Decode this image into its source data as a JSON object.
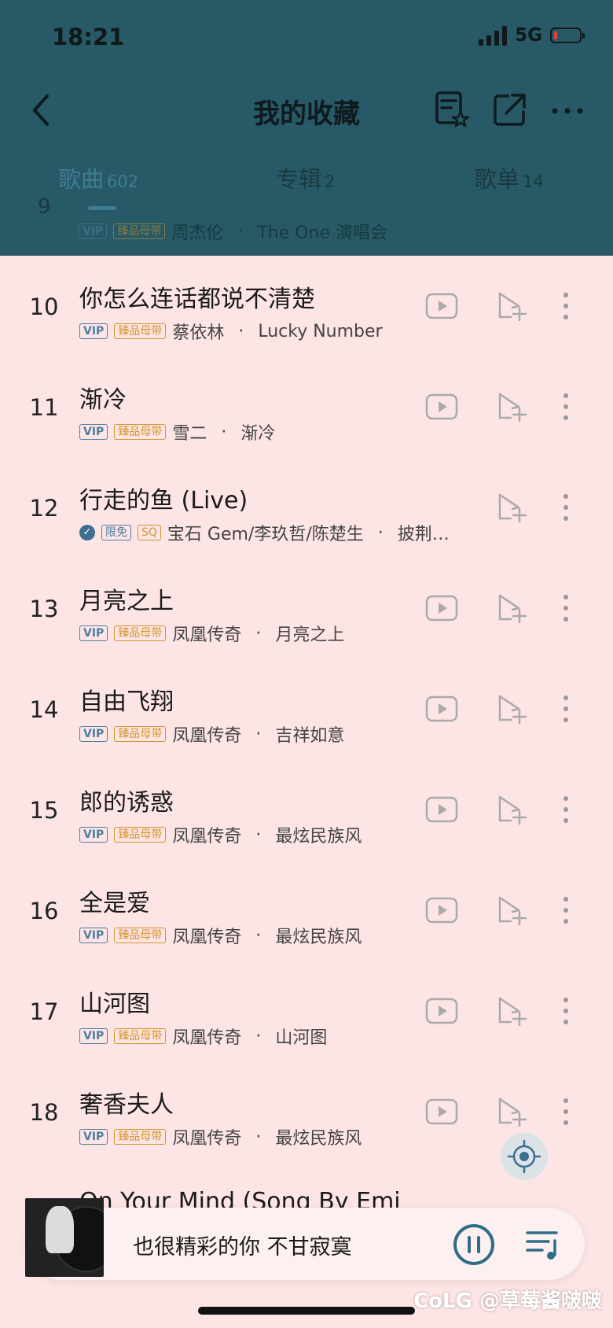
{
  "status_bar": {
    "time": "18:21",
    "network": "5G"
  },
  "nav": {
    "title": "我的收藏"
  },
  "tabs": [
    {
      "label": "歌曲",
      "count": "602"
    },
    {
      "label": "专辑",
      "count": "2"
    },
    {
      "label": "歌单",
      "count": "14"
    }
  ],
  "ghost_row": {
    "num": "9",
    "badge_vip": "VIP",
    "badge_gold": "臻品母带",
    "artist": "周杰伦",
    "dot": "·",
    "album": "The One 演唱会"
  },
  "songs": [
    {
      "num": "10",
      "title": "你怎么连话都说不清楚",
      "badge_vip": "VIP",
      "badge_gold": "臻品母带",
      "artist": "蔡依林",
      "dot": "·",
      "album": "Lucky Number"
    },
    {
      "num": "11",
      "title": "渐冷",
      "badge_vip": "VIP",
      "badge_gold": "臻品母带",
      "artist": "雪二",
      "dot": "·",
      "album": "渐冷"
    },
    {
      "num": "12",
      "title": "行走的鱼 (Live)",
      "check": "✓",
      "badge_free": "限免",
      "badge_sq": "SQ",
      "artist": "宝石 Gem/李玖哲/陈楚生",
      "dot": "·",
      "album": "披荆…"
    },
    {
      "num": "13",
      "title": "月亮之上",
      "badge_vip": "VIP",
      "badge_gold": "臻品母带",
      "artist": "凤凰传奇",
      "dot": "·",
      "album": "月亮之上"
    },
    {
      "num": "14",
      "title": "自由飞翔",
      "badge_vip": "VIP",
      "badge_gold": "臻品母带",
      "artist": "凤凰传奇",
      "dot": "·",
      "album": "吉祥如意"
    },
    {
      "num": "15",
      "title": "郎的诱惑",
      "badge_vip": "VIP",
      "badge_gold": "臻品母带",
      "artist": "凤凰传奇",
      "dot": "·",
      "album": "最炫民族风"
    },
    {
      "num": "16",
      "title": "全是爱",
      "badge_vip": "VIP",
      "badge_gold": "臻品母带",
      "artist": "凤凰传奇",
      "dot": "·",
      "album": "最炫民族风"
    },
    {
      "num": "17",
      "title": "山河图",
      "badge_vip": "VIP",
      "badge_gold": "臻品母带",
      "artist": "凤凰传奇",
      "dot": "·",
      "album": "山河图"
    },
    {
      "num": "18",
      "title": "奢香夫人",
      "badge_vip": "VIP",
      "badge_gold": "臻品母带",
      "artist": "凤凰传奇",
      "dot": "·",
      "album": "最炫民族风"
    }
  ],
  "partial_song": {
    "title": "On Your Mind (Song By Emi"
  },
  "player": {
    "now_playing": "也很精彩的你 不甘寂寞"
  },
  "watermark": "CoLG @草莓酱啵啵",
  "icons": {
    "back": "chevron-left-icon",
    "playlist_star": "playlist-star-icon",
    "share": "share-icon",
    "more": "more-horizontal-icon",
    "mv": "play-video-icon",
    "add": "add-to-playlist-icon",
    "row_more": "more-vertical-icon",
    "locate": "locate-icon",
    "pause": "pause-icon",
    "queue": "queue-icon"
  },
  "colors": {
    "header_bg": "#275a66",
    "list_bg": "#fde4e5",
    "accent": "#3d7c93",
    "vip": "#4d7fa0",
    "gold": "#d4952e"
  }
}
